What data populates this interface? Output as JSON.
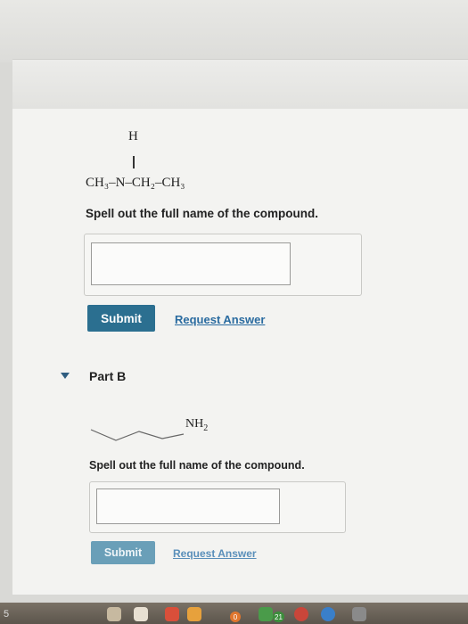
{
  "part_a": {
    "structure": {
      "h_atom": "H",
      "formula": "CH₃–N–CH₂–CH₃"
    },
    "prompt": "Spell out the full name of the compound.",
    "answer_value": "",
    "submit_label": "Submit",
    "request_label": "Request Answer"
  },
  "part_b": {
    "label": "Part B",
    "structure": {
      "group": "NH",
      "subscript": "2"
    },
    "prompt": "Spell out the full name of the compound.",
    "answer_value": "",
    "submit_label": "Submit",
    "request_label": "Request Answer"
  },
  "dock": {
    "left_number": "5",
    "badge_orange": "0",
    "badge_green": "21"
  },
  "colors": {
    "submit_button": "#2b6f90",
    "link": "#2a6ba0",
    "panel": "#f3f3f1"
  }
}
